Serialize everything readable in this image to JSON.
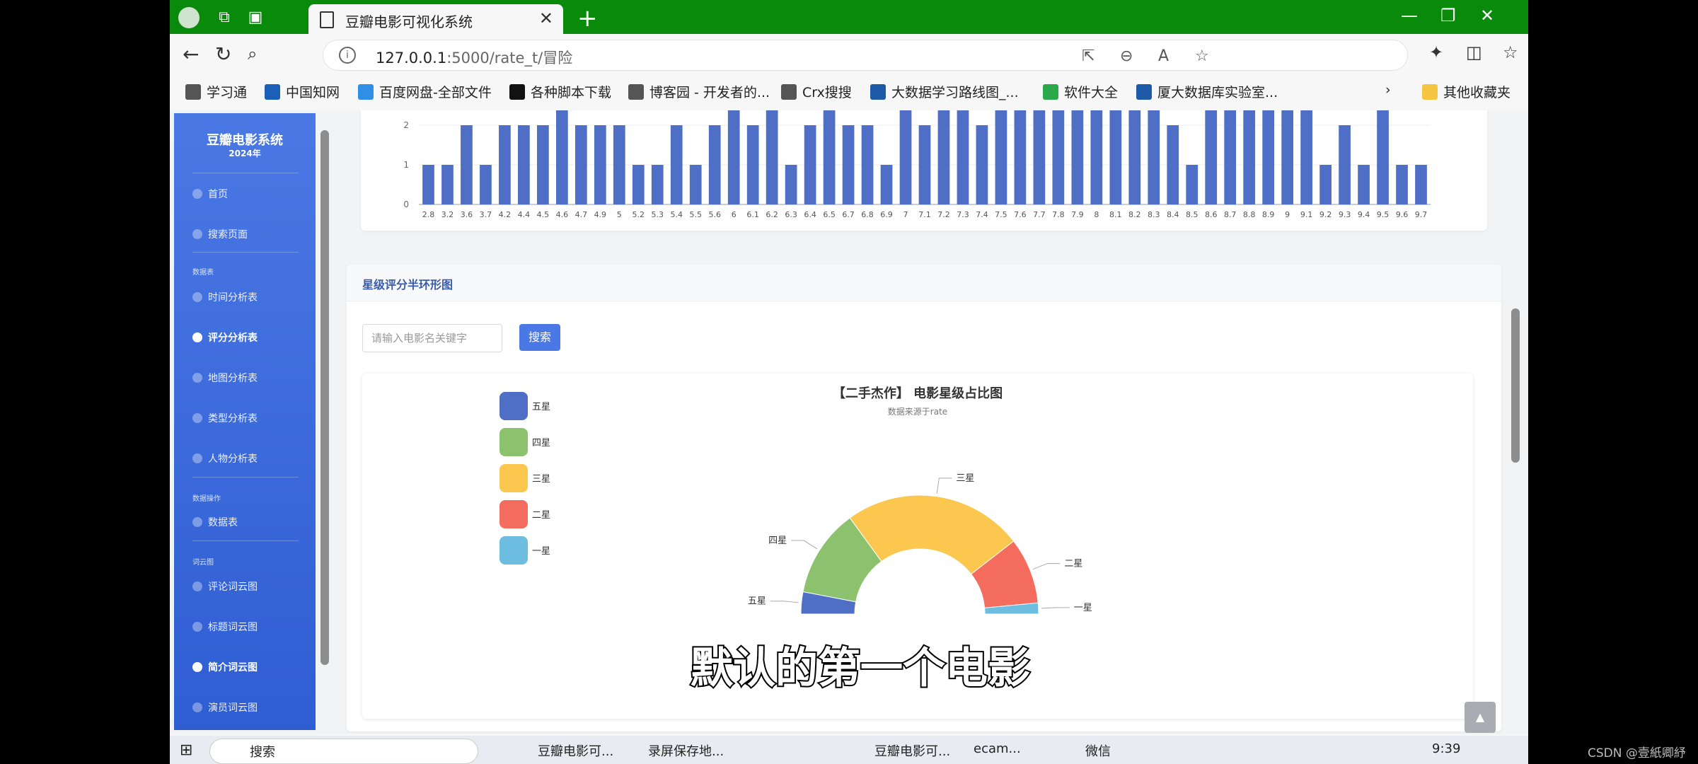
{
  "browser": {
    "tab_title": "豆瓣电影可视化系统",
    "url_host": "127.0.0.1",
    "url_rest": ":5000/rate_t/冒险"
  },
  "bookmarks": [
    {
      "label": "学习通",
      "color": "#555555"
    },
    {
      "label": "中国知网",
      "color": "#1b5fb8"
    },
    {
      "label": "百度网盘-全部文件",
      "color": "#2f8ee6"
    },
    {
      "label": "各种脚本下载",
      "color": "#111111"
    },
    {
      "label": "博客园 - 开发者的...",
      "color": "#555555"
    },
    {
      "label": "Crx搜搜",
      "color": "#555555"
    },
    {
      "label": "大数据学习路线图_...",
      "color": "#1d5aa8"
    },
    {
      "label": "软件大全",
      "color": "#2aa84a"
    },
    {
      "label": "厦大数据库实验室...",
      "color": "#1d5aa8"
    }
  ],
  "bookmarks_other": "其他收藏夹",
  "sidebar": {
    "title": "豆瓣电影系统",
    "year": "2024年",
    "items": [
      {
        "label": "首页",
        "group": ""
      },
      {
        "label": "搜索页面",
        "group": ""
      },
      {
        "label": "时间分析表",
        "group": "数据表"
      },
      {
        "label": "评分分析表",
        "group": "",
        "active": true
      },
      {
        "label": "地图分析表",
        "group": ""
      },
      {
        "label": "类型分析表",
        "group": ""
      },
      {
        "label": "人物分析表",
        "group": ""
      },
      {
        "label": "数据表",
        "group": "数据操作"
      },
      {
        "label": "评论词云图",
        "group": "词云图"
      },
      {
        "label": "标题词云图",
        "group": ""
      },
      {
        "label": "简介词云图",
        "group": "",
        "active": true
      },
      {
        "label": "演员词云图",
        "group": ""
      }
    ],
    "groups": [
      "数据表",
      "数据操作",
      "词云图"
    ]
  },
  "panel": {
    "title": "星级评分半环形图",
    "search_placeholder": "请输入电影名关键字",
    "search_button": "搜索"
  },
  "chart_data": [
    {
      "type": "bar",
      "categories": [
        "2.8",
        "3.2",
        "3.6",
        "3.7",
        "4.2",
        "4.4",
        "4.5",
        "4.6",
        "4.7",
        "4.9",
        "5",
        "5.2",
        "5.3",
        "5.4",
        "5.5",
        "5.6",
        "6",
        "6.1",
        "6.2",
        "6.3",
        "6.4",
        "6.5",
        "6.7",
        "6.8",
        "6.9",
        "7",
        "7.1",
        "7.2",
        "7.3",
        "7.4",
        "7.5",
        "7.6",
        "7.7",
        "7.8",
        "7.9",
        "8",
        "8.1",
        "8.2",
        "8.3",
        "8.4",
        "8.5",
        "8.6",
        "8.7",
        "8.8",
        "8.9",
        "9",
        "9.1",
        "9.2",
        "9.3",
        "9.4",
        "9.5",
        "9.6",
        "9.7"
      ],
      "values": [
        1,
        1,
        2,
        1,
        2,
        2,
        2,
        3,
        2,
        2,
        2,
        1,
        1,
        2,
        1,
        2,
        3,
        2,
        3,
        1,
        2,
        3,
        2,
        2,
        1,
        3,
        2,
        3,
        3,
        2,
        3,
        3,
        3,
        3,
        3,
        3,
        3,
        3,
        3,
        2,
        1,
        3,
        3,
        3,
        3,
        3,
        3,
        1,
        2,
        1,
        3,
        1,
        1
      ],
      "yticks": [
        0,
        1,
        2
      ],
      "color": "#4f6fc7"
    },
    {
      "type": "pie",
      "title": "【二手杰作】 电影星级占比图",
      "subtitle": "数据来源于rate",
      "legend_position": "top-left",
      "slices": [
        {
          "name": "五星",
          "value": 6,
          "color": "#4f6fc7"
        },
        {
          "name": "四星",
          "value": 24,
          "color": "#8cc26e"
        },
        {
          "name": "三星",
          "value": 49,
          "color": "#fbc74e"
        },
        {
          "name": "二星",
          "value": 18,
          "color": "#f46c5d"
        },
        {
          "name": "一星",
          "value": 3,
          "color": "#6cbde0"
        }
      ]
    }
  ],
  "subtitle_caption": "默认的第一个电影",
  "backtop_icon": "caret-up-icon",
  "taskbar": {
    "search": "搜索",
    "items": [
      "豆瓣电影可...",
      "录屏保存地...",
      "豆瓣电影可...",
      "ecam...",
      "微信"
    ],
    "time": "9:39"
  },
  "watermark": "CSDN @壹紙卿紓"
}
